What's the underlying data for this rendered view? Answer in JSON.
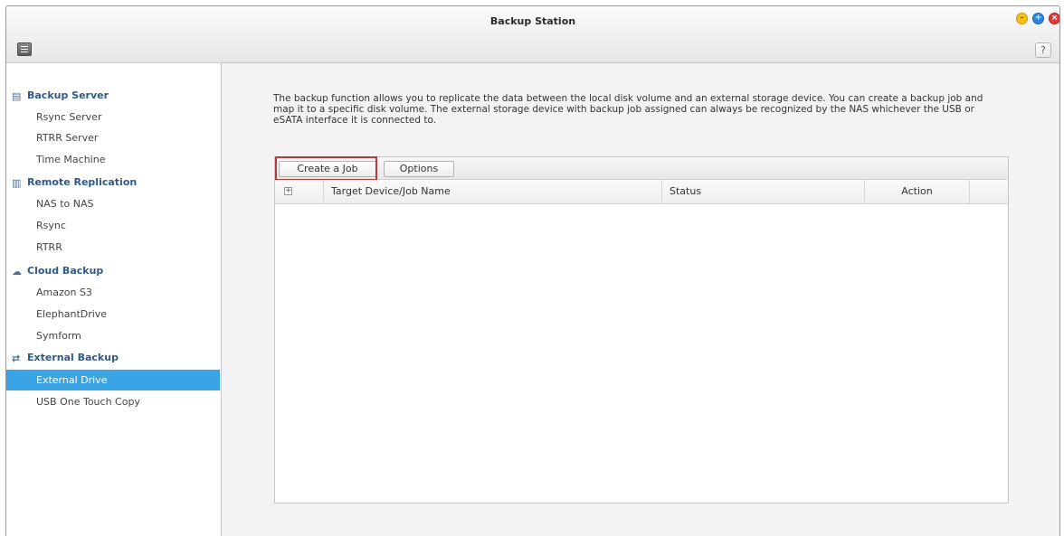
{
  "window": {
    "title": "Backup Station",
    "help_label": "?",
    "controls": [
      "minimize-icon",
      "maximize-icon",
      "close-icon"
    ]
  },
  "sidebar": {
    "groups": [
      {
        "title": "Backup Server",
        "icon": "server-icon",
        "items": [
          "Rsync Server",
          "RTRR Server",
          "Time Machine"
        ]
      },
      {
        "title": "Remote Replication",
        "icon": "replication-icon",
        "items": [
          "NAS to NAS",
          "Rsync",
          "RTRR"
        ]
      },
      {
        "title": "Cloud Backup",
        "icon": "cloud-icon",
        "items": [
          "Amazon S3",
          "ElephantDrive",
          "Symform"
        ]
      },
      {
        "title": "External Backup",
        "icon": "sync-icon",
        "items": [
          "External Drive",
          "USB One Touch Copy"
        ]
      }
    ],
    "active_item": "External Drive"
  },
  "main": {
    "description": "The backup function allows you to replicate the data between the local disk volume and an external storage device. You can create a backup job and map it to a specific disk volume. The external storage device with backup job assigned can always be recognized by the NAS whichever the USB or eSATA interface it is connected to.",
    "toolbar": {
      "create_label": "Create a Job",
      "options_label": "Options"
    },
    "table": {
      "expand_symbol": "+",
      "columns": [
        "Target Device/Job Name",
        "Status",
        "Action"
      ],
      "rows": []
    }
  },
  "colors": {
    "accent": "#3aa3e3",
    "highlight_border": "#b53a3a",
    "group_title": "#2e5a8a"
  }
}
